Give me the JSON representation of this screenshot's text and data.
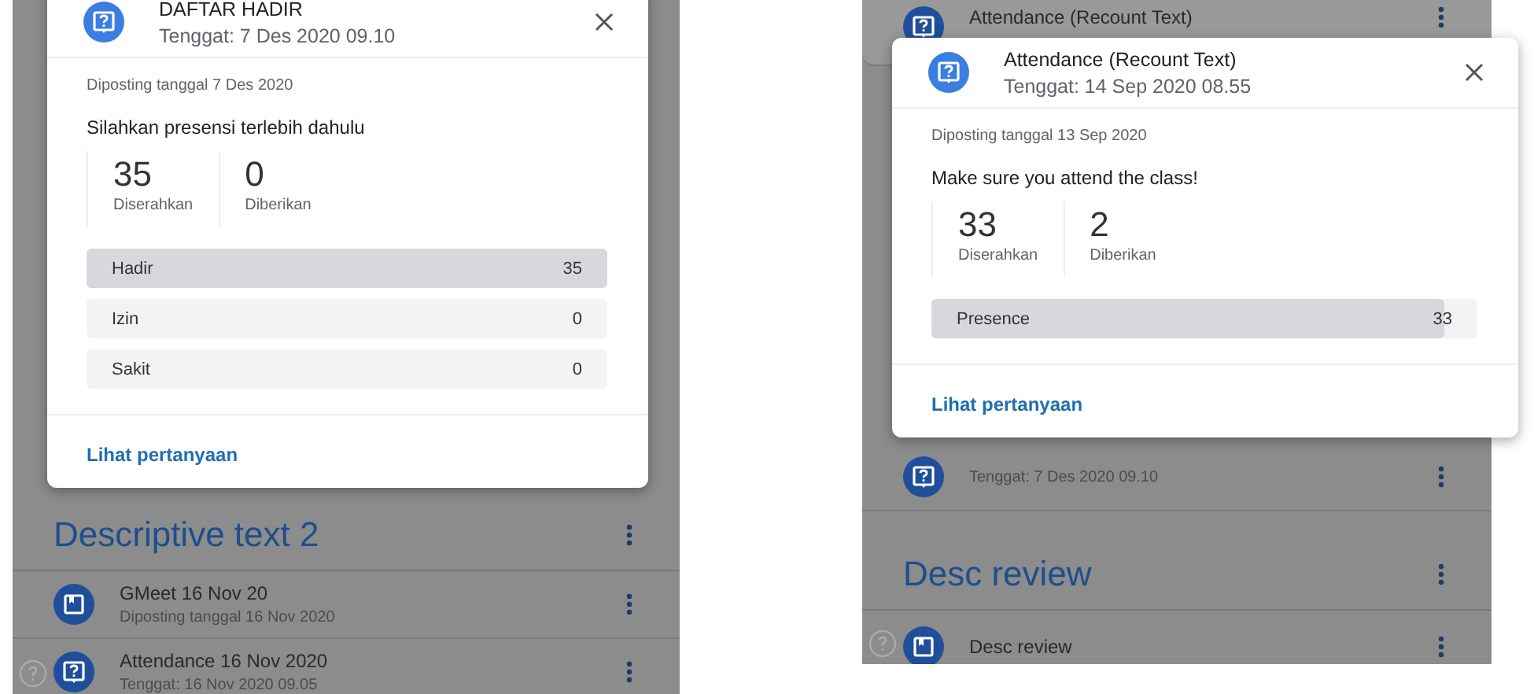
{
  "screens": [
    {
      "stream": [
        {
          "kind": "section",
          "title": "Descriptive text 2"
        },
        {
          "kind": "material",
          "title": "GMeet 16 Nov 20",
          "subtitle": "Diposting tanggal 16 Nov 2020"
        },
        {
          "kind": "question",
          "title": "Attendance 16 Nov 2020",
          "subtitle": "Tenggat: 16 Nov 2020 09.05"
        }
      ],
      "dialog": {
        "kind": "question",
        "title": "DAFTAR HADIR",
        "due": "Tenggat: 7 Des 2020 09.10",
        "posted": "Diposting tanggal 7 Des 2020",
        "instruction": "Silahkan presensi terlebih dahulu",
        "stats": [
          {
            "value": "35",
            "label": "Diserahkan"
          },
          {
            "value": "0",
            "label": "Diberikan"
          }
        ],
        "rows": [
          {
            "label": "Hadir",
            "count": "35",
            "level": 1
          },
          {
            "label": "Izin",
            "count": "0",
            "level": 0
          },
          {
            "label": "Sakit",
            "count": "0",
            "level": 0
          }
        ],
        "link": "Lihat pertanyaan"
      }
    },
    {
      "stream": [
        {
          "kind": "question",
          "title": "Attendance (Recount Text)"
        },
        {
          "kind": "question",
          "subtitle": "Tenggat: 7 Des 2020 09.10"
        },
        {
          "kind": "section",
          "title": "Desc review"
        },
        {
          "kind": "material",
          "title": "Desc review"
        }
      ],
      "dialog": {
        "kind": "question",
        "title": "Attendance (Recount Text)",
        "due": "Tenggat: 14 Sep 2020 08.55",
        "posted": "Diposting tanggal 13 Sep 2020",
        "instruction": "Make sure you attend the class!",
        "stats": [
          {
            "value": "33",
            "label": "Diserahkan"
          },
          {
            "value": "2",
            "label": "Diberikan"
          }
        ],
        "rows": [
          {
            "label": "Presence",
            "count": "33",
            "level": 0.94
          }
        ],
        "link": "Lihat pertanyaan"
      }
    }
  ]
}
